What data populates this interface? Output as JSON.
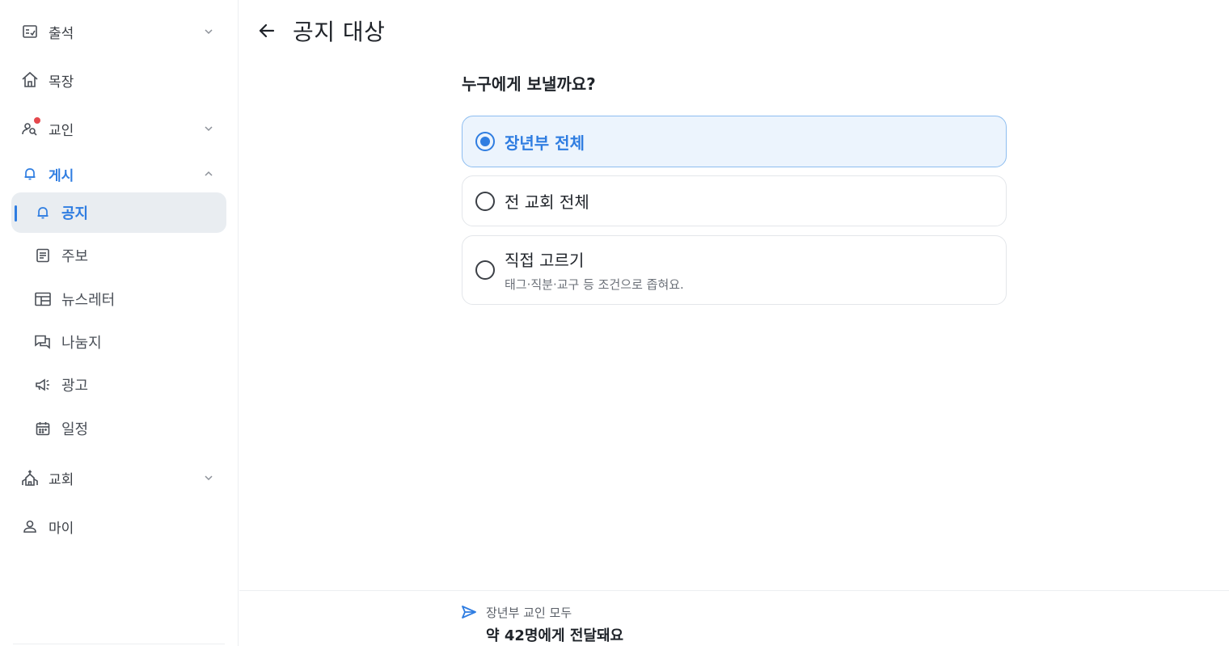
{
  "sidebar": {
    "items": [
      {
        "label": "출석",
        "icon": "checklist-icon",
        "chevron": "chevron-down"
      },
      {
        "label": "목장",
        "icon": "house-icon"
      },
      {
        "label": "교인",
        "icon": "people-search-icon",
        "chevron": "chevron-down",
        "badge": true
      },
      {
        "label": "게시",
        "icon": "bell-icon",
        "chevron": "chevron-up",
        "expanded": true
      },
      {
        "label": "교회",
        "icon": "church-icon",
        "chevron": "chevron-down"
      },
      {
        "label": "마이",
        "icon": "person-icon"
      }
    ],
    "sub_items": [
      {
        "label": "공지",
        "icon": "bell-icon",
        "active": true
      },
      {
        "label": "주보",
        "icon": "document-icon"
      },
      {
        "label": "뉴스레터",
        "icon": "newsletter-icon"
      },
      {
        "label": "나눔지",
        "icon": "chat-icon"
      },
      {
        "label": "광고",
        "icon": "megaphone-icon"
      },
      {
        "label": "일정",
        "icon": "calendar-icon"
      }
    ]
  },
  "header": {
    "title": "공지 대상",
    "back_icon": "arrow-left-icon"
  },
  "main": {
    "question": "누구에게 보낼까요?",
    "options": [
      {
        "title": "장년부 전체",
        "selected": true
      },
      {
        "title": "전 교회 전체",
        "selected": false
      },
      {
        "title": "직접 고르기",
        "subtitle": "태그·직분·교구 등 조건으로 좁혀요.",
        "selected": false
      }
    ]
  },
  "footer": {
    "icon": "send-icon",
    "subtitle": "장년부 교인 모두",
    "summary": "약 42명에게 전달돼요"
  },
  "colors": {
    "accent": "#2f7de1",
    "selected_bg": "#ecf4fd",
    "active_nav_bg": "#e9edf1",
    "badge": "#e5484d"
  }
}
